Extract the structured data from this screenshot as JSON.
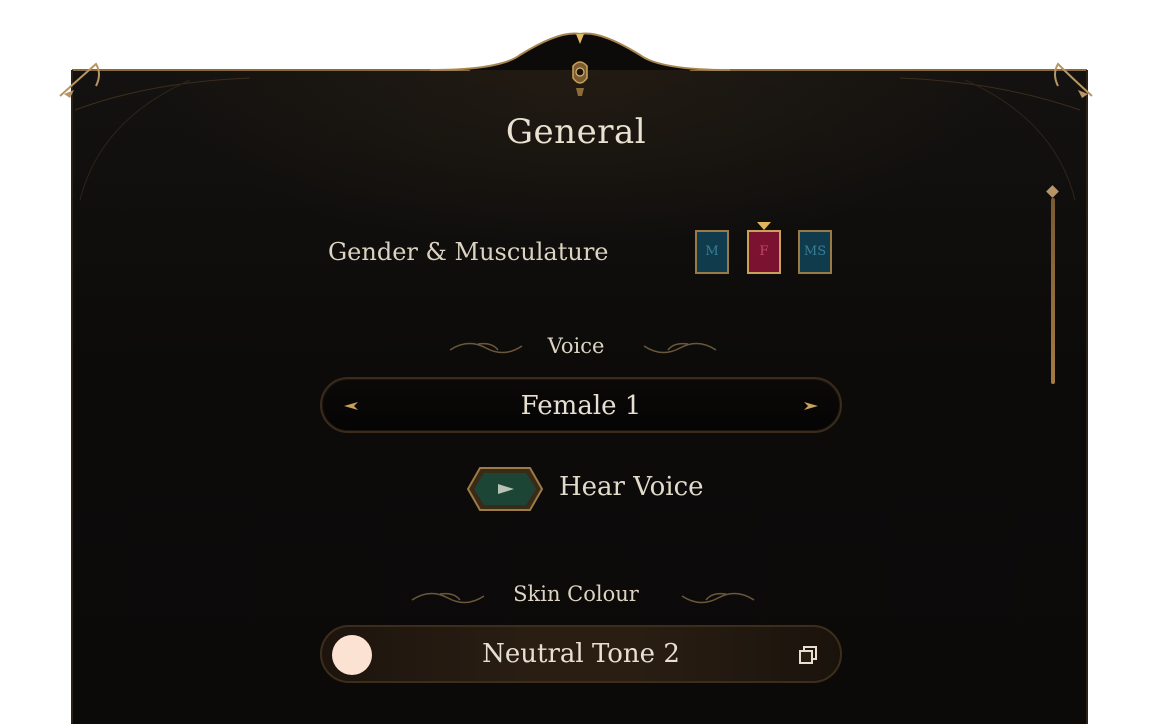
{
  "panel": {
    "title": "General",
    "crest_icon": "mask-crest-icon"
  },
  "gender": {
    "label": "Gender & Musculature",
    "options": [
      {
        "id": "m",
        "label": "M",
        "selected": false
      },
      {
        "id": "f",
        "label": "F",
        "selected": true
      },
      {
        "id": "ms",
        "label": "MS",
        "selected": false
      }
    ]
  },
  "voice": {
    "heading": "Voice",
    "value": "Female 1",
    "prev_icon": "arrow-left-icon",
    "next_icon": "arrow-right-icon",
    "hear_label": "Hear Voice",
    "play_icon": "play-icon"
  },
  "skin": {
    "heading": "Skin Colour",
    "value": "Neutral Tone 2",
    "swatch_color": "#fbe2d3",
    "copy_icon": "copy-icon"
  },
  "colors": {
    "accent_gold": "#b79564",
    "male_blue": "#0f3b4d",
    "female_red": "#7a1230"
  }
}
